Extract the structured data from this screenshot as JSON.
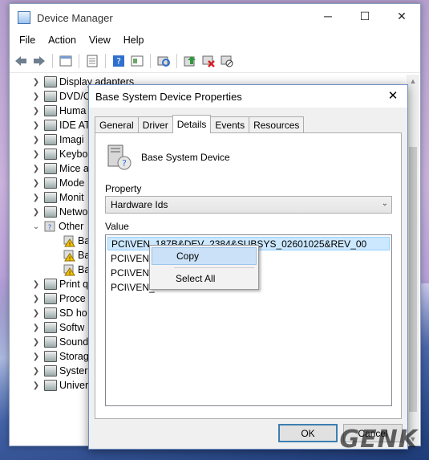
{
  "window": {
    "title": "Device Manager",
    "controls": {
      "minimize": "─",
      "maximize": "☐",
      "close": "✕"
    }
  },
  "menu": [
    "File",
    "Action",
    "View",
    "Help"
  ],
  "toolbar_icons": [
    "back-arrow-icon",
    "forward-arrow-icon",
    "show-hide-tree-icon",
    "properties-icon",
    "help-icon",
    "device-view-icon",
    "scan-hardware-icon",
    "update-driver-icon",
    "uninstall-device-icon",
    "disable-device-icon"
  ],
  "tree": [
    {
      "label": "Display adapters",
      "expanded": false
    },
    {
      "label": "DVD/C",
      "expanded": false
    },
    {
      "label": "Huma",
      "expanded": false
    },
    {
      "label": "IDE AT",
      "expanded": false
    },
    {
      "label": "Imagi",
      "expanded": false
    },
    {
      "label": "Keybo",
      "expanded": false
    },
    {
      "label": "Mice a",
      "expanded": false
    },
    {
      "label": "Mode",
      "expanded": false
    },
    {
      "label": "Monit",
      "expanded": false
    },
    {
      "label": "Netwo",
      "expanded": false
    },
    {
      "label": "Other",
      "expanded": true
    },
    {
      "label": "Ba",
      "child": true,
      "warning": true
    },
    {
      "label": "Ba",
      "child": true,
      "warning": true
    },
    {
      "label": "Ba",
      "child": true,
      "warning": true
    },
    {
      "label": "Print q",
      "expanded": false
    },
    {
      "label": "Proce",
      "expanded": false
    },
    {
      "label": "SD ho",
      "expanded": false
    },
    {
      "label": "Softw",
      "expanded": false
    },
    {
      "label": "Sound",
      "expanded": false
    },
    {
      "label": "Storag",
      "expanded": false
    },
    {
      "label": "Syster",
      "expanded": false
    },
    {
      "label": "Univer",
      "expanded": false
    }
  ],
  "dialog": {
    "title": "Base System Device Properties",
    "close": "✕",
    "tabs": [
      "General",
      "Driver",
      "Details",
      "Events",
      "Resources"
    ],
    "active_tab": "Details",
    "device_name": "Base System Device",
    "property_label": "Property",
    "property_value": "Hardware Ids",
    "value_label": "Value",
    "values": [
      "PCI\\VEN_187B&DEV_2384&SUBSYS_02601025&REV_00",
      "PCI\\VEN_                                         _02601025",
      "PCI\\VEN_                                         00",
      "PCI\\VEN_"
    ],
    "context_menu": [
      "Copy",
      "Select All"
    ],
    "ok": "OK",
    "cancel": "Cancel"
  },
  "watermark": "GENK"
}
